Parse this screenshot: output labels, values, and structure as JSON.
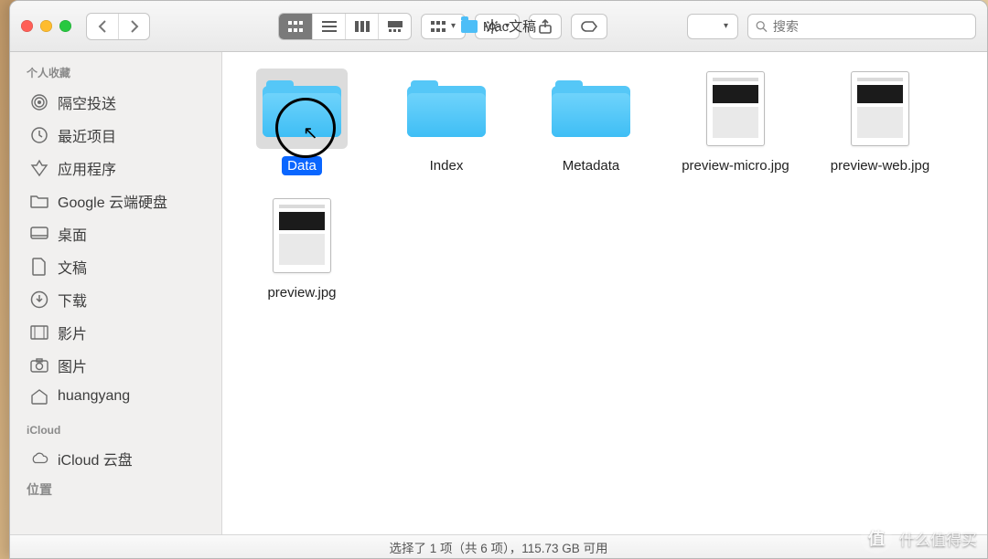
{
  "window": {
    "title": "Mac文稿"
  },
  "search": {
    "placeholder": "搜索"
  },
  "sidebar": {
    "sections": [
      {
        "header": "个人收藏",
        "items": [
          {
            "icon": "airdrop",
            "label": "隔空投送"
          },
          {
            "icon": "clock",
            "label": "最近项目"
          },
          {
            "icon": "apps",
            "label": "应用程序"
          },
          {
            "icon": "gdrive",
            "label": "Google 云端硬盘"
          },
          {
            "icon": "desktop",
            "label": "桌面"
          },
          {
            "icon": "doc",
            "label": "文稿"
          },
          {
            "icon": "download",
            "label": "下载"
          },
          {
            "icon": "movie",
            "label": "影片"
          },
          {
            "icon": "camera",
            "label": "图片"
          },
          {
            "icon": "home",
            "label": "huangyang"
          }
        ]
      },
      {
        "header": "iCloud",
        "items": [
          {
            "icon": "cloud",
            "label": "iCloud 云盘"
          }
        ]
      }
    ],
    "cutoff": "位置"
  },
  "items": [
    {
      "kind": "folder",
      "name": "Data",
      "selected": true
    },
    {
      "kind": "folder",
      "name": "Index",
      "selected": false
    },
    {
      "kind": "folder",
      "name": "Metadata",
      "selected": false
    },
    {
      "kind": "image",
      "name": "preview-micro.jpg",
      "selected": false
    },
    {
      "kind": "image",
      "name": "preview-web.jpg",
      "selected": false
    },
    {
      "kind": "image",
      "name": "preview.jpg",
      "selected": false
    }
  ],
  "status": {
    "text": "选择了 1 项（共 6 项），115.73 GB 可用"
  },
  "watermark": {
    "badge": "值",
    "text": "什么值得买"
  }
}
